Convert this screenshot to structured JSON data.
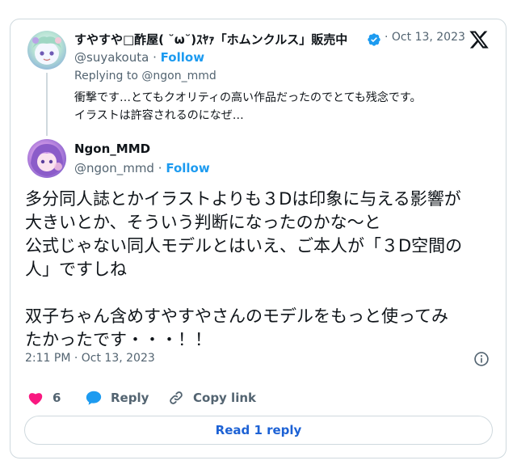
{
  "quoted_tweet": {
    "author_name": "すやすや□酢屋( ˘ω˘)ｽﾔｧ「ホムンクルス」販売中",
    "handle": "@suyakouta",
    "follow_label": "Follow",
    "date": "Oct 13, 2023",
    "replying_label": "Replying to @ngon_mmd",
    "text_lines": [
      "衝撃です…とてもクオリティの高い作品だったのでとても残念です。",
      "イラストは許容されるのになぜ…"
    ]
  },
  "main_tweet": {
    "author_name": "Ngon_MMD",
    "handle": "@ngon_mmd",
    "follow_label": "Follow",
    "text_lines": [
      "多分同人誌とかイラストよりも３Dは印象に与える影響が",
      "大きいとか、そういう判断になったのかな〜と",
      "公式じゃない同人モデルとはいえ、ご本人が「３D空間の",
      "人」ですしね",
      "",
      "双子ちゃん含めすやすやさんのモデルをもっと使ってみ",
      "たかったです・・・！！"
    ],
    "timestamp": "2:11 PM · Oct 13, 2023"
  },
  "actions": {
    "like_count": "6",
    "reply_label": "Reply",
    "copy_link_label": "Copy link"
  },
  "read_reply_label": "Read 1 reply",
  "icons": {
    "logo": "x-logo-icon",
    "verified": "verified-badge-icon",
    "info": "info-icon",
    "like": "heart-icon",
    "reply": "speech-bubble-icon",
    "copy": "link-icon"
  },
  "colors": {
    "accent": "#1d9bf0",
    "like": "#f91880",
    "muted": "#536471",
    "border": "#cfd9de"
  }
}
